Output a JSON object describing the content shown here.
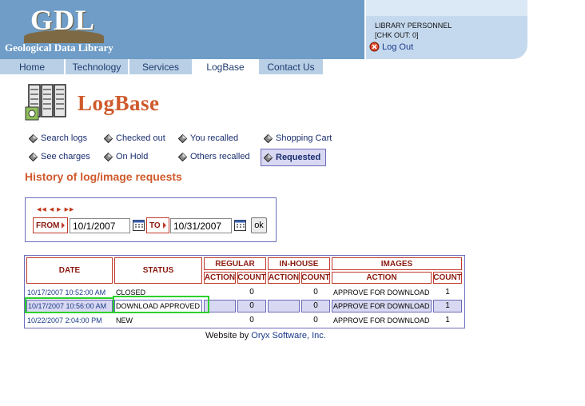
{
  "header": {
    "logo_text": "GDL",
    "logo_subtitle": "Geological Data Library",
    "personnel_line1": "LIBRARY PERSONNEL",
    "personnel_line2": "[CHK OUT: 0]",
    "logout_label": "Log Out"
  },
  "nav": {
    "tabs": [
      {
        "label": "Home"
      },
      {
        "label": "Technology"
      },
      {
        "label": "Services"
      },
      {
        "label": "LogBase"
      },
      {
        "label": "Contact Us"
      }
    ],
    "active": "LogBase"
  },
  "page_title": "LogBase",
  "menu": {
    "items": [
      {
        "label": "Search logs"
      },
      {
        "label": "Checked out"
      },
      {
        "label": "You recalled"
      },
      {
        "label": "Shopping Cart"
      },
      {
        "label": "See charges"
      },
      {
        "label": "On Hold"
      },
      {
        "label": "Others recalled"
      },
      {
        "label": "Requested"
      }
    ],
    "selected": "Requested"
  },
  "section_title": "History of log/image requests",
  "filter": {
    "from_label": "FROM",
    "from_value": "10/1/2007",
    "to_label": "TO",
    "to_value": "10/31/2007",
    "ok_label": "ok"
  },
  "table": {
    "headers": {
      "date": "DATE",
      "status": "STATUS",
      "regular": "REGULAR",
      "inhouse": "IN-HOUSE",
      "images": "IMAGES",
      "action": "ACTION",
      "count": "COUNT"
    },
    "rows": [
      {
        "date": "10/17/2007 10:52:00 AM",
        "status": "CLOSED",
        "regular_count": "0",
        "inhouse_count": "0",
        "images_action": "APPROVE FOR DOWNLOAD",
        "images_count": "1"
      },
      {
        "date": "10/17/2007 10:56:00 AM",
        "status": "DOWNLOAD APPROVED",
        "regular_count": "0",
        "inhouse_count": "0",
        "images_action": "APPROVE FOR DOWNLOAD",
        "images_count": "1"
      },
      {
        "date": "10/22/2007 2:04:00 PM",
        "status": "NEW",
        "regular_count": "0",
        "inhouse_count": "0",
        "images_action": "APPROVE FOR DOWNLOAD",
        "images_count": "1"
      }
    ]
  },
  "footer": {
    "prefix": "Website by",
    "link": "Oryx Software, Inc."
  },
  "colors": {
    "header_blue": "#6f9dc7",
    "nav_tab": "#b9cfe6",
    "title_orange": "#cf5a2c",
    "table_border_red": "#c0392b",
    "highlight_lavender": "#d8d8f2",
    "selection_green": "#2bd12b",
    "link_blue": "#1a3a8a"
  }
}
